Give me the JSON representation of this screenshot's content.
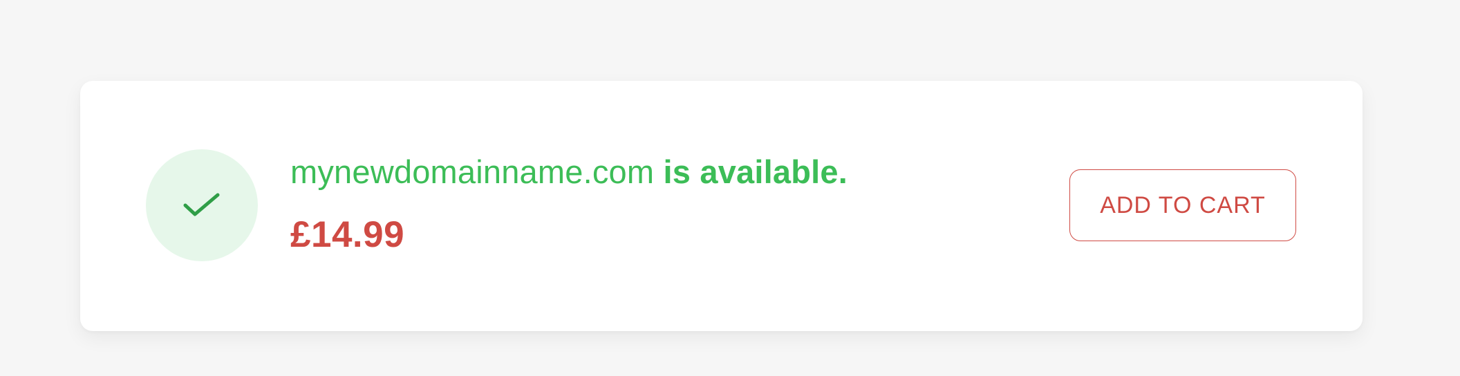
{
  "result": {
    "status_icon": "checkmark-icon",
    "domain": "mynewdomainname.com",
    "availability_text": "is available.",
    "price": "£14.99",
    "add_to_cart_label": "ADD TO CART"
  },
  "colors": {
    "background": "#f6f6f6",
    "card": "#ffffff",
    "success_green": "#3cbd57",
    "success_green_dark": "#2f9e47",
    "success_tint": "#e6f7ea",
    "price_red": "#cf4a43"
  }
}
